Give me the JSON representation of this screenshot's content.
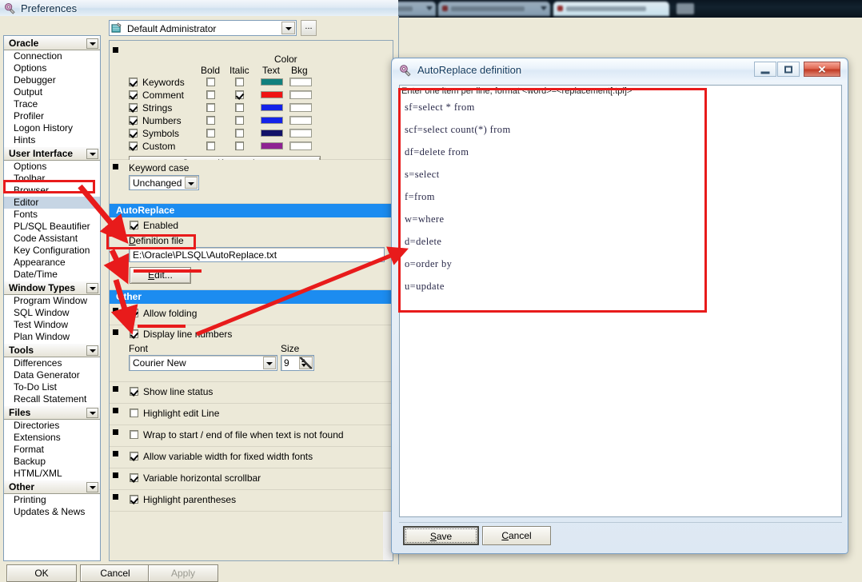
{
  "window": {
    "title": "Preferences",
    "icon": "preferences-icon"
  },
  "admin": {
    "icon": "admin-profile-icon",
    "value": "Default Administrator",
    "browse_label": "...",
    "dropdown_icon": "chevron-down-icon"
  },
  "tree": {
    "groups": [
      {
        "title": "Oracle",
        "items": [
          "Connection",
          "Options",
          "Debugger",
          "Output",
          "Trace",
          "Profiler",
          "Logon History",
          "Hints"
        ]
      },
      {
        "title": "User Interface",
        "items": [
          "Options",
          "Toolbar",
          "Browser",
          "Editor",
          "Fonts",
          "PL/SQL Beautifier",
          "Code Assistant",
          "Key Configuration",
          "Appearance",
          "Date/Time"
        ],
        "selected": "Editor"
      },
      {
        "title": "Window Types",
        "items": [
          "Program Window",
          "SQL Window",
          "Test Window",
          "Plan Window"
        ]
      },
      {
        "title": "Tools",
        "items": [
          "Differences",
          "Data Generator",
          "To-Do List",
          "Recall Statement"
        ]
      },
      {
        "title": "Files",
        "items": [
          "Directories",
          "Extensions",
          "Format",
          "Backup",
          "HTML/XML"
        ]
      },
      {
        "title": "Other",
        "items": [
          "Printing",
          "Updates & News"
        ]
      }
    ]
  },
  "syntax": {
    "color_header": "Color",
    "columns": [
      "Bold",
      "Italic",
      "Text",
      "Bkg"
    ],
    "rows": [
      {
        "label": "Keywords",
        "enabled": true,
        "bold": false,
        "italic": false,
        "text_color": "#11807e",
        "bkg_color": "#ffffff"
      },
      {
        "label": "Comment",
        "enabled": true,
        "bold": false,
        "italic": true,
        "text_color": "#ef1414",
        "bkg_color": "#ffffff"
      },
      {
        "label": "Strings",
        "enabled": true,
        "bold": false,
        "italic": false,
        "text_color": "#1423e8",
        "bkg_color": "#ffffff"
      },
      {
        "label": "Numbers",
        "enabled": true,
        "bold": false,
        "italic": false,
        "text_color": "#1423e8",
        "bkg_color": "#ffffff"
      },
      {
        "label": "Symbols",
        "enabled": true,
        "bold": false,
        "italic": false,
        "text_color": "#121268",
        "bkg_color": "#ffffff"
      },
      {
        "label": "Custom",
        "enabled": true,
        "bold": false,
        "italic": false,
        "text_color": "#8e2392",
        "bkg_color": "#ffffff"
      }
    ],
    "custom_keywords_button": "Custom Keywords..."
  },
  "keyword_case": {
    "label": "Keyword case",
    "value": "Unchanged"
  },
  "autoreplace_section": {
    "header": "AutoReplace",
    "enabled_label": "Enabled",
    "enabled": true,
    "definition_file_label": "Definition file",
    "definition_file_value": "E:\\Oracle\\PLSQL\\AutoReplace.txt",
    "edit_button": "Edit..."
  },
  "other_section": {
    "header": "Other",
    "options": [
      {
        "label": "Allow folding",
        "checked": true
      },
      {
        "label": "Display line numbers",
        "checked": true
      },
      {
        "label": "Show line status",
        "checked": true
      },
      {
        "label": "Highlight edit Line",
        "checked": false
      },
      {
        "label": "Wrap to start / end of file when text is not found",
        "checked": false
      },
      {
        "label": "Allow variable width for fixed width fonts",
        "checked": true
      },
      {
        "label": "Variable horizontal scrollbar",
        "checked": true
      },
      {
        "label": "Highlight parentheses",
        "checked": true
      }
    ],
    "font_label": "Font",
    "font_value": "Courier New",
    "size_label": "Size",
    "size_value": "9"
  },
  "footer": {
    "ok": "OK",
    "cancel": "Cancel",
    "apply": "Apply"
  },
  "dialog": {
    "title": "AutoReplace definition",
    "icon": "autoreplace-icon",
    "hint": "Enter one item per line, format <word>=<replacement[.tpl]>",
    "lines": [
      "sf=select * from",
      "scf=select count(*) from",
      "df=delete from",
      "s=select",
      "f=from",
      "w=where",
      "d=delete",
      "o=order by",
      "u=update"
    ],
    "save_button": "Save",
    "save_accel": "S",
    "cancel_button": "Cancel",
    "cancel_accel": "C",
    "minimize_icon": "minimize-icon",
    "maximize_icon": "maximize-icon",
    "close_icon": "close-icon",
    "close_glyph": "✕"
  },
  "annotations": {
    "color": "#e81b1b",
    "boxes": [
      "editor-tree-item",
      "autoreplace-header",
      "memo-area"
    ],
    "underlines": [
      "enabled-checkbox",
      "edit-button"
    ]
  }
}
